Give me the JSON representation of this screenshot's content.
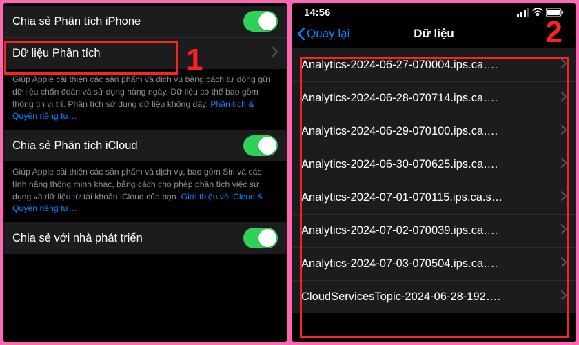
{
  "annotations": {
    "one": "1",
    "two": "2"
  },
  "panel1": {
    "rows": [
      {
        "label": "Chia sẻ Phân tích iPhone",
        "type": "toggle",
        "on": true
      },
      {
        "label": "Dữ liệu Phân tích",
        "type": "nav"
      }
    ],
    "footer1_a": "Giúp Apple cải thiện các sản phẩm và dịch vụ bằng cách tự động gửi dữ liệu chẩn đoán và sử dụng hàng ngày. Dữ liệu có thể bao gồm thông tin vị trí. Phân tích sử dụng dữ liệu không dây. ",
    "footer1_link": "Phân tích & Quyền riêng tư…",
    "rows2": [
      {
        "label": "Chia sẻ Phân tích iCloud",
        "type": "toggle",
        "on": true
      }
    ],
    "footer2_a": "Giúp Apple cải thiện các sản phẩm và dịch vụ, bao gồm Siri và các tính năng thông minh khác, bằng cách cho phép phân tích việc sử dụng và dữ liệu từ tài khoản iCloud của bạn. ",
    "footer2_link": "Giới thiệu về iCloud & Quyền riêng tư…",
    "rows3": [
      {
        "label": "Chia sẻ với nhà phát triển",
        "type": "toggle",
        "on": true
      }
    ]
  },
  "panel2": {
    "time": "14:56",
    "back": "Quay lại",
    "title": "Dữ liệu",
    "files": [
      "Analytics-2024-06-27-070004.ips.ca….",
      "Analytics-2024-06-28-070714.ips.ca….",
      "Analytics-2024-06-29-070100.ips.ca….",
      "Analytics-2024-06-30-070625.ips.ca….",
      "Analytics-2024-07-01-070115.ips.ca.s…",
      "Analytics-2024-07-02-070039.ips.ca….",
      "Analytics-2024-07-03-070504.ips.ca….",
      "CloudServicesTopic-2024-06-28-192…."
    ]
  }
}
